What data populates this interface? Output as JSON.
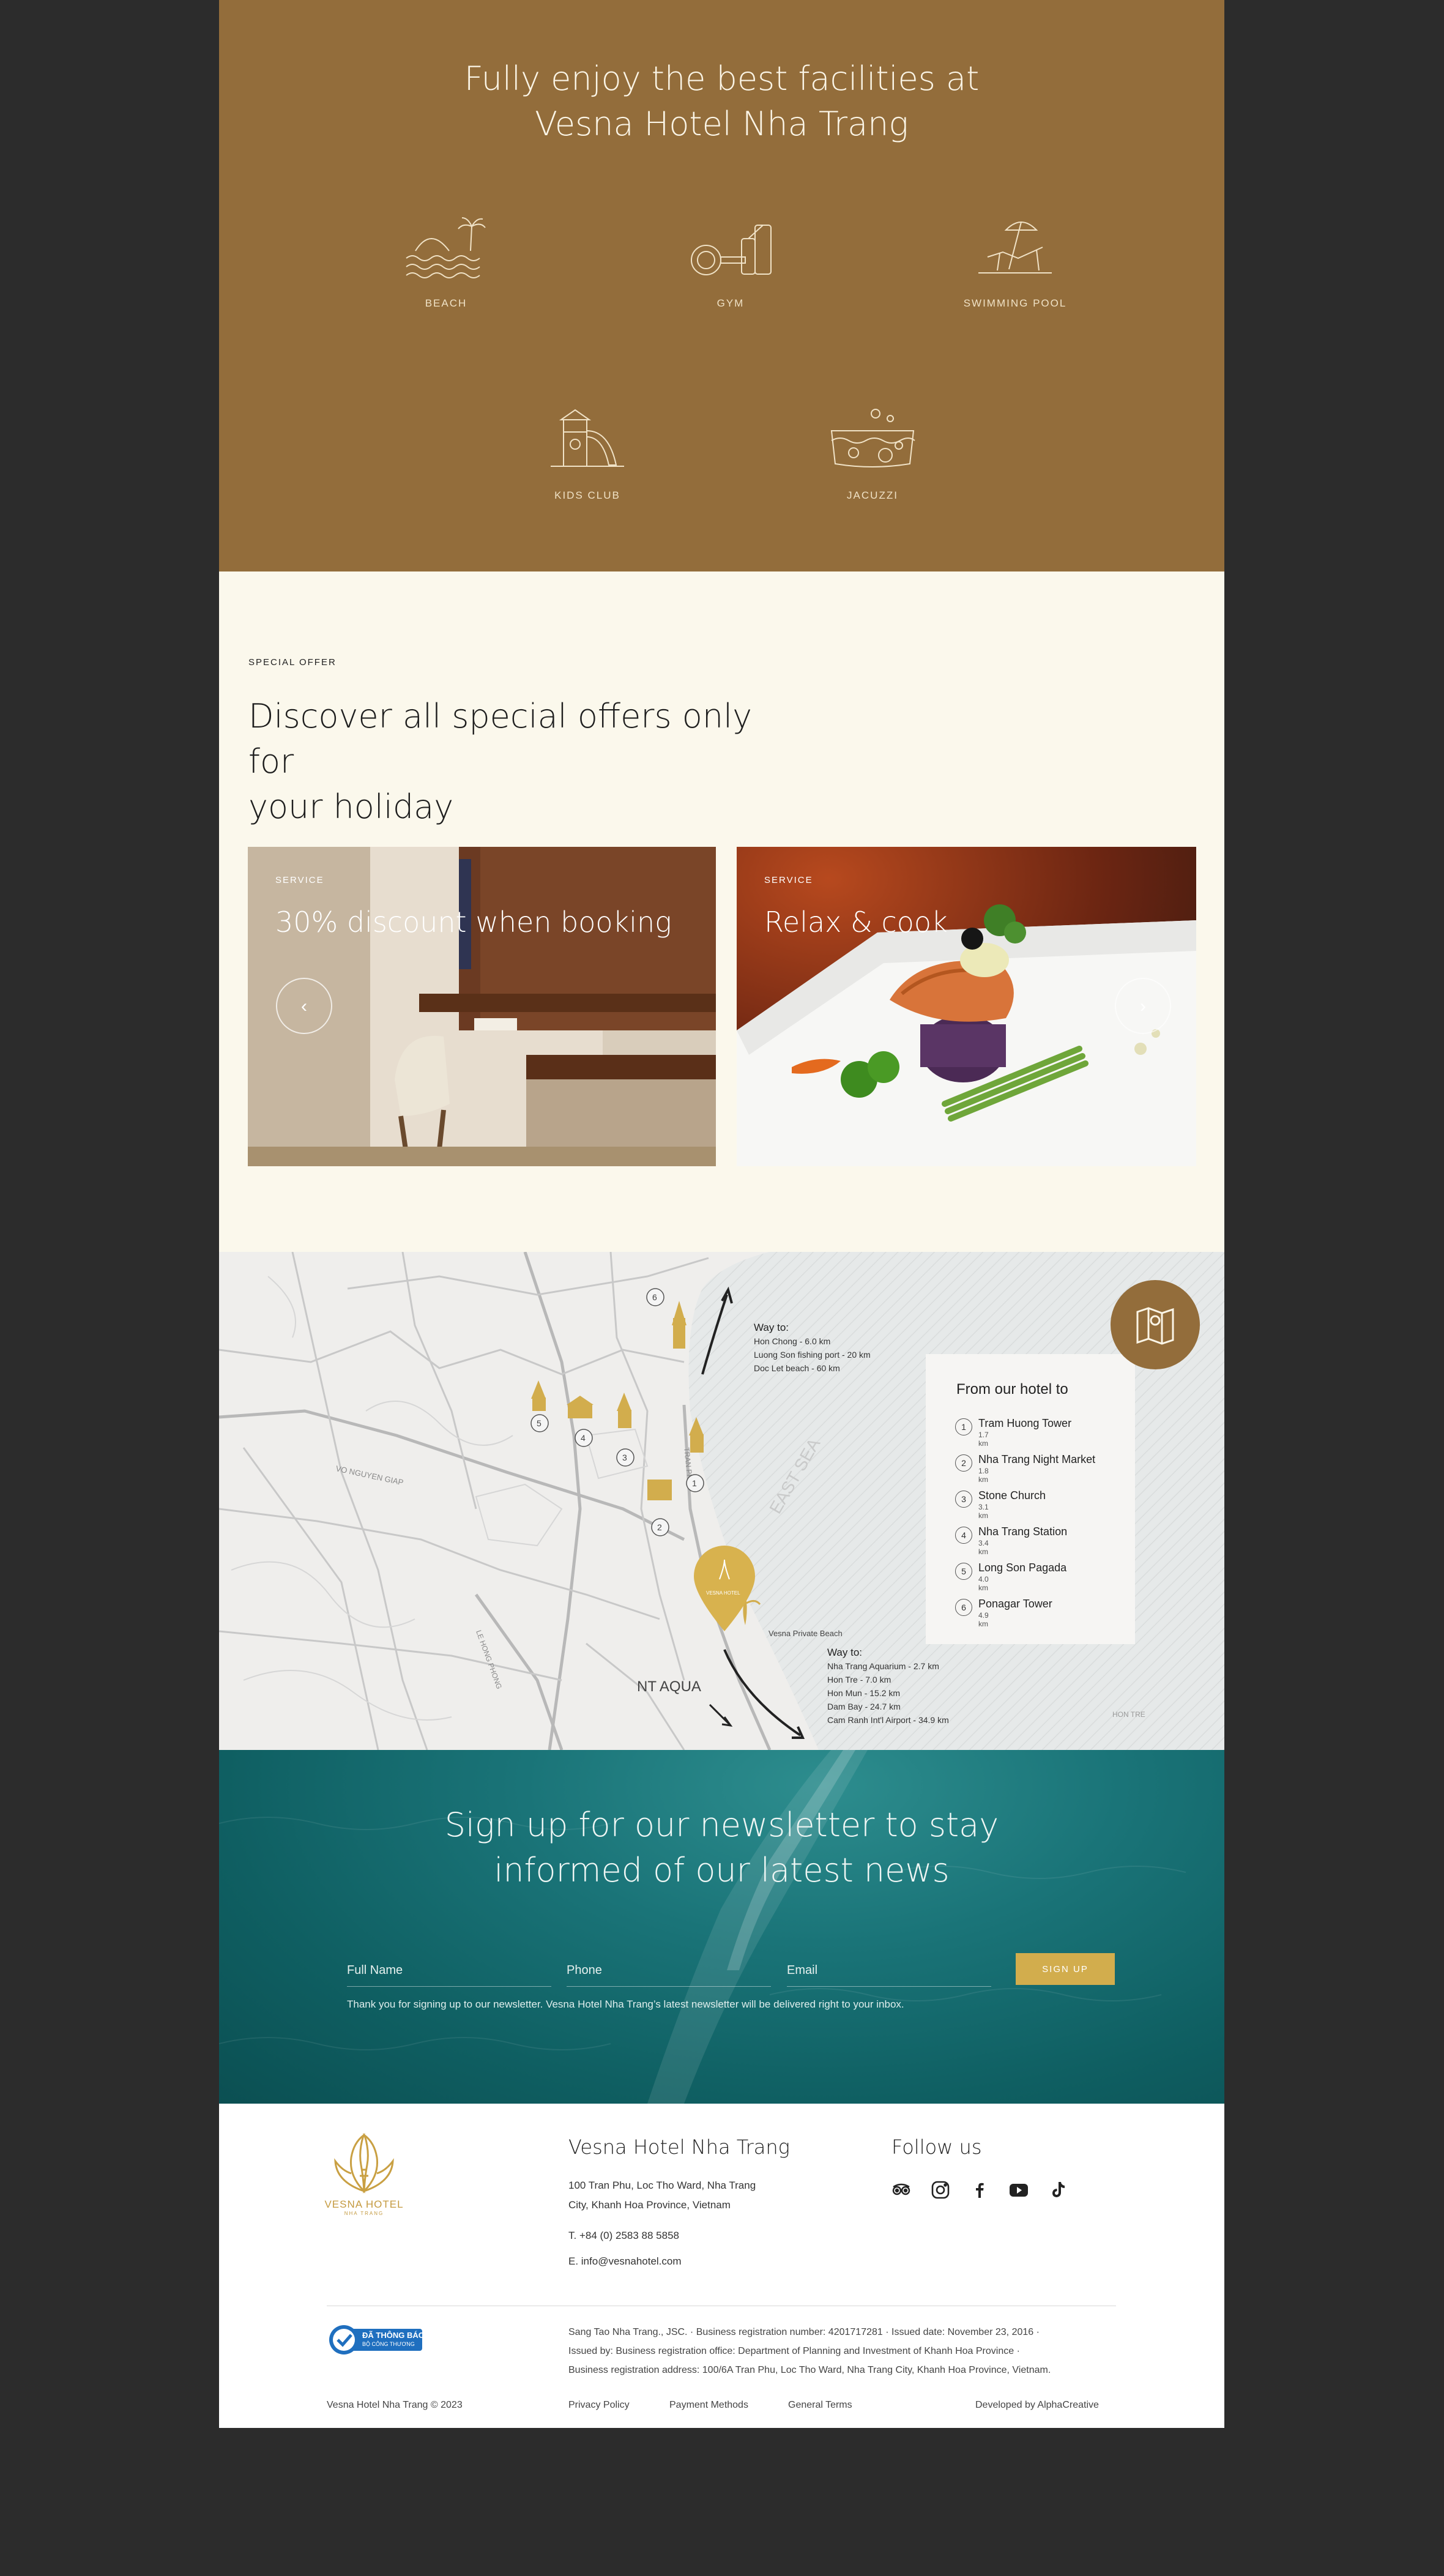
{
  "facilities": {
    "title_line1": "Fully enjoy the best facilities at",
    "title_line2": "Vesna Hotel Nha Trang",
    "items": [
      {
        "label": "BEACH",
        "icon": "beach-icon"
      },
      {
        "label": "GYM",
        "icon": "gym-icon"
      },
      {
        "label": "SWIMMING POOL",
        "icon": "swimming-pool-icon"
      },
      {
        "label": "KIDS CLUB",
        "icon": "kids-club-icon"
      },
      {
        "label": "JACUZZI",
        "icon": "jacuzzi-icon"
      }
    ]
  },
  "offers": {
    "eyebrow": "SPECIAL OFFER",
    "title_line1": "Discover all special offers only for",
    "title_line2": "your holiday",
    "cards": [
      {
        "tag": "SERVICE",
        "title": "30% discount when booking"
      },
      {
        "tag": "SERVICE",
        "title": "Relax & cook"
      }
    ],
    "prev_icon": "chevron-left-icon",
    "next_icon": "chevron-right-icon"
  },
  "map": {
    "legend_title": "From our hotel to",
    "legend": [
      {
        "num": "1",
        "name": "Tram Huong Tower",
        "dist": "1.7 km"
      },
      {
        "num": "2",
        "name": "Nha Trang Night Market",
        "dist": "1.8 km"
      },
      {
        "num": "3",
        "name": "Stone Church",
        "dist": "3.1 km"
      },
      {
        "num": "4",
        "name": "Nha Trang Station",
        "dist": "3.4 km"
      },
      {
        "num": "5",
        "name": "Long Son Pagada",
        "dist": "4.0 km"
      },
      {
        "num": "6",
        "name": "Ponagar Tower",
        "dist": "4.9 km"
      }
    ],
    "way_north": {
      "title": "Way to:",
      "lines": [
        "Hon Chong - 6.0 km",
        "Luong Son fishing port - 20 km",
        "Doc Let beach - 60 km"
      ]
    },
    "way_south": {
      "title": "Way to:",
      "lines": [
        "Nha Trang Aquarium - 2.7 km",
        "Hon Tre - 7.0 km",
        "Hon Mun - 15.2 km",
        "Dam Bay - 24.7 km",
        "Cam Ranh Int'l Airport - 34.9 km"
      ]
    },
    "labels": {
      "east_sea": "EAST SEA",
      "private_beach": "Vesna Private Beach",
      "nt_aqua": "NT AQUA",
      "hon_tre": "HON TRE",
      "pin_label": "VESNA HOTEL"
    },
    "button_icon": "map-icon"
  },
  "newsletter": {
    "title_line1": "Sign up for our newsletter to stay",
    "title_line2": "informed of our latest news",
    "name_placeholder": "Full Name",
    "phone_placeholder": "Phone",
    "email_placeholder": "Email",
    "button": "SIGN UP",
    "thanks": "Thank you for signing up to our newsletter. Vesna Hotel Nha Trang’s latest newsletter will be delivered right to your inbox."
  },
  "footer": {
    "logo_text": "VESNA HOTEL",
    "logo_sub": "NHA TRANG",
    "hotel_name": "Vesna Hotel Nha Trang",
    "address_line1": "100 Tran Phu, Loc Tho Ward, Nha Trang",
    "address_line2": "City, Khanh Hoa Province, Vietnam",
    "phone": "T. +84 (0) 2583 88 5858",
    "email": "E. info@vesnahotel.com",
    "follow": "Follow us",
    "social": [
      "tripadvisor-icon",
      "instagram-icon",
      "facebook-icon",
      "youtube-icon",
      "tiktok-icon"
    ],
    "badge_line1": "ĐÃ THÔNG BÁO",
    "badge_line2": "BỘ CÔNG THƯƠNG",
    "legal_line1": "Sang Tao Nha Trang., JSC. · Business registration number: 4201717281 · Issued date: November 23, 2016 ·",
    "legal_line2": "Issued by: Business registration office: Department of Planning and Investment of Khanh Hoa Province ·",
    "legal_line3": "Business registration address: 100/6A Tran Phu, Loc Tho Ward, Nha Trang City, Khanh Hoa Province, Vietnam.",
    "copyright": "Vesna Hotel Nha Trang © 2023",
    "privacy": "Privacy Policy",
    "payment": "Payment Methods",
    "terms": "General Terms",
    "developed": "Developed by AlphaCreative"
  },
  "colors": {
    "facilities_bg": "#936d3b",
    "offers_bg": "#fbf8ec",
    "newsletter_bg": "#1a7478",
    "accent_gold": "#d2ad4d",
    "map_bg": "#efeeec"
  }
}
